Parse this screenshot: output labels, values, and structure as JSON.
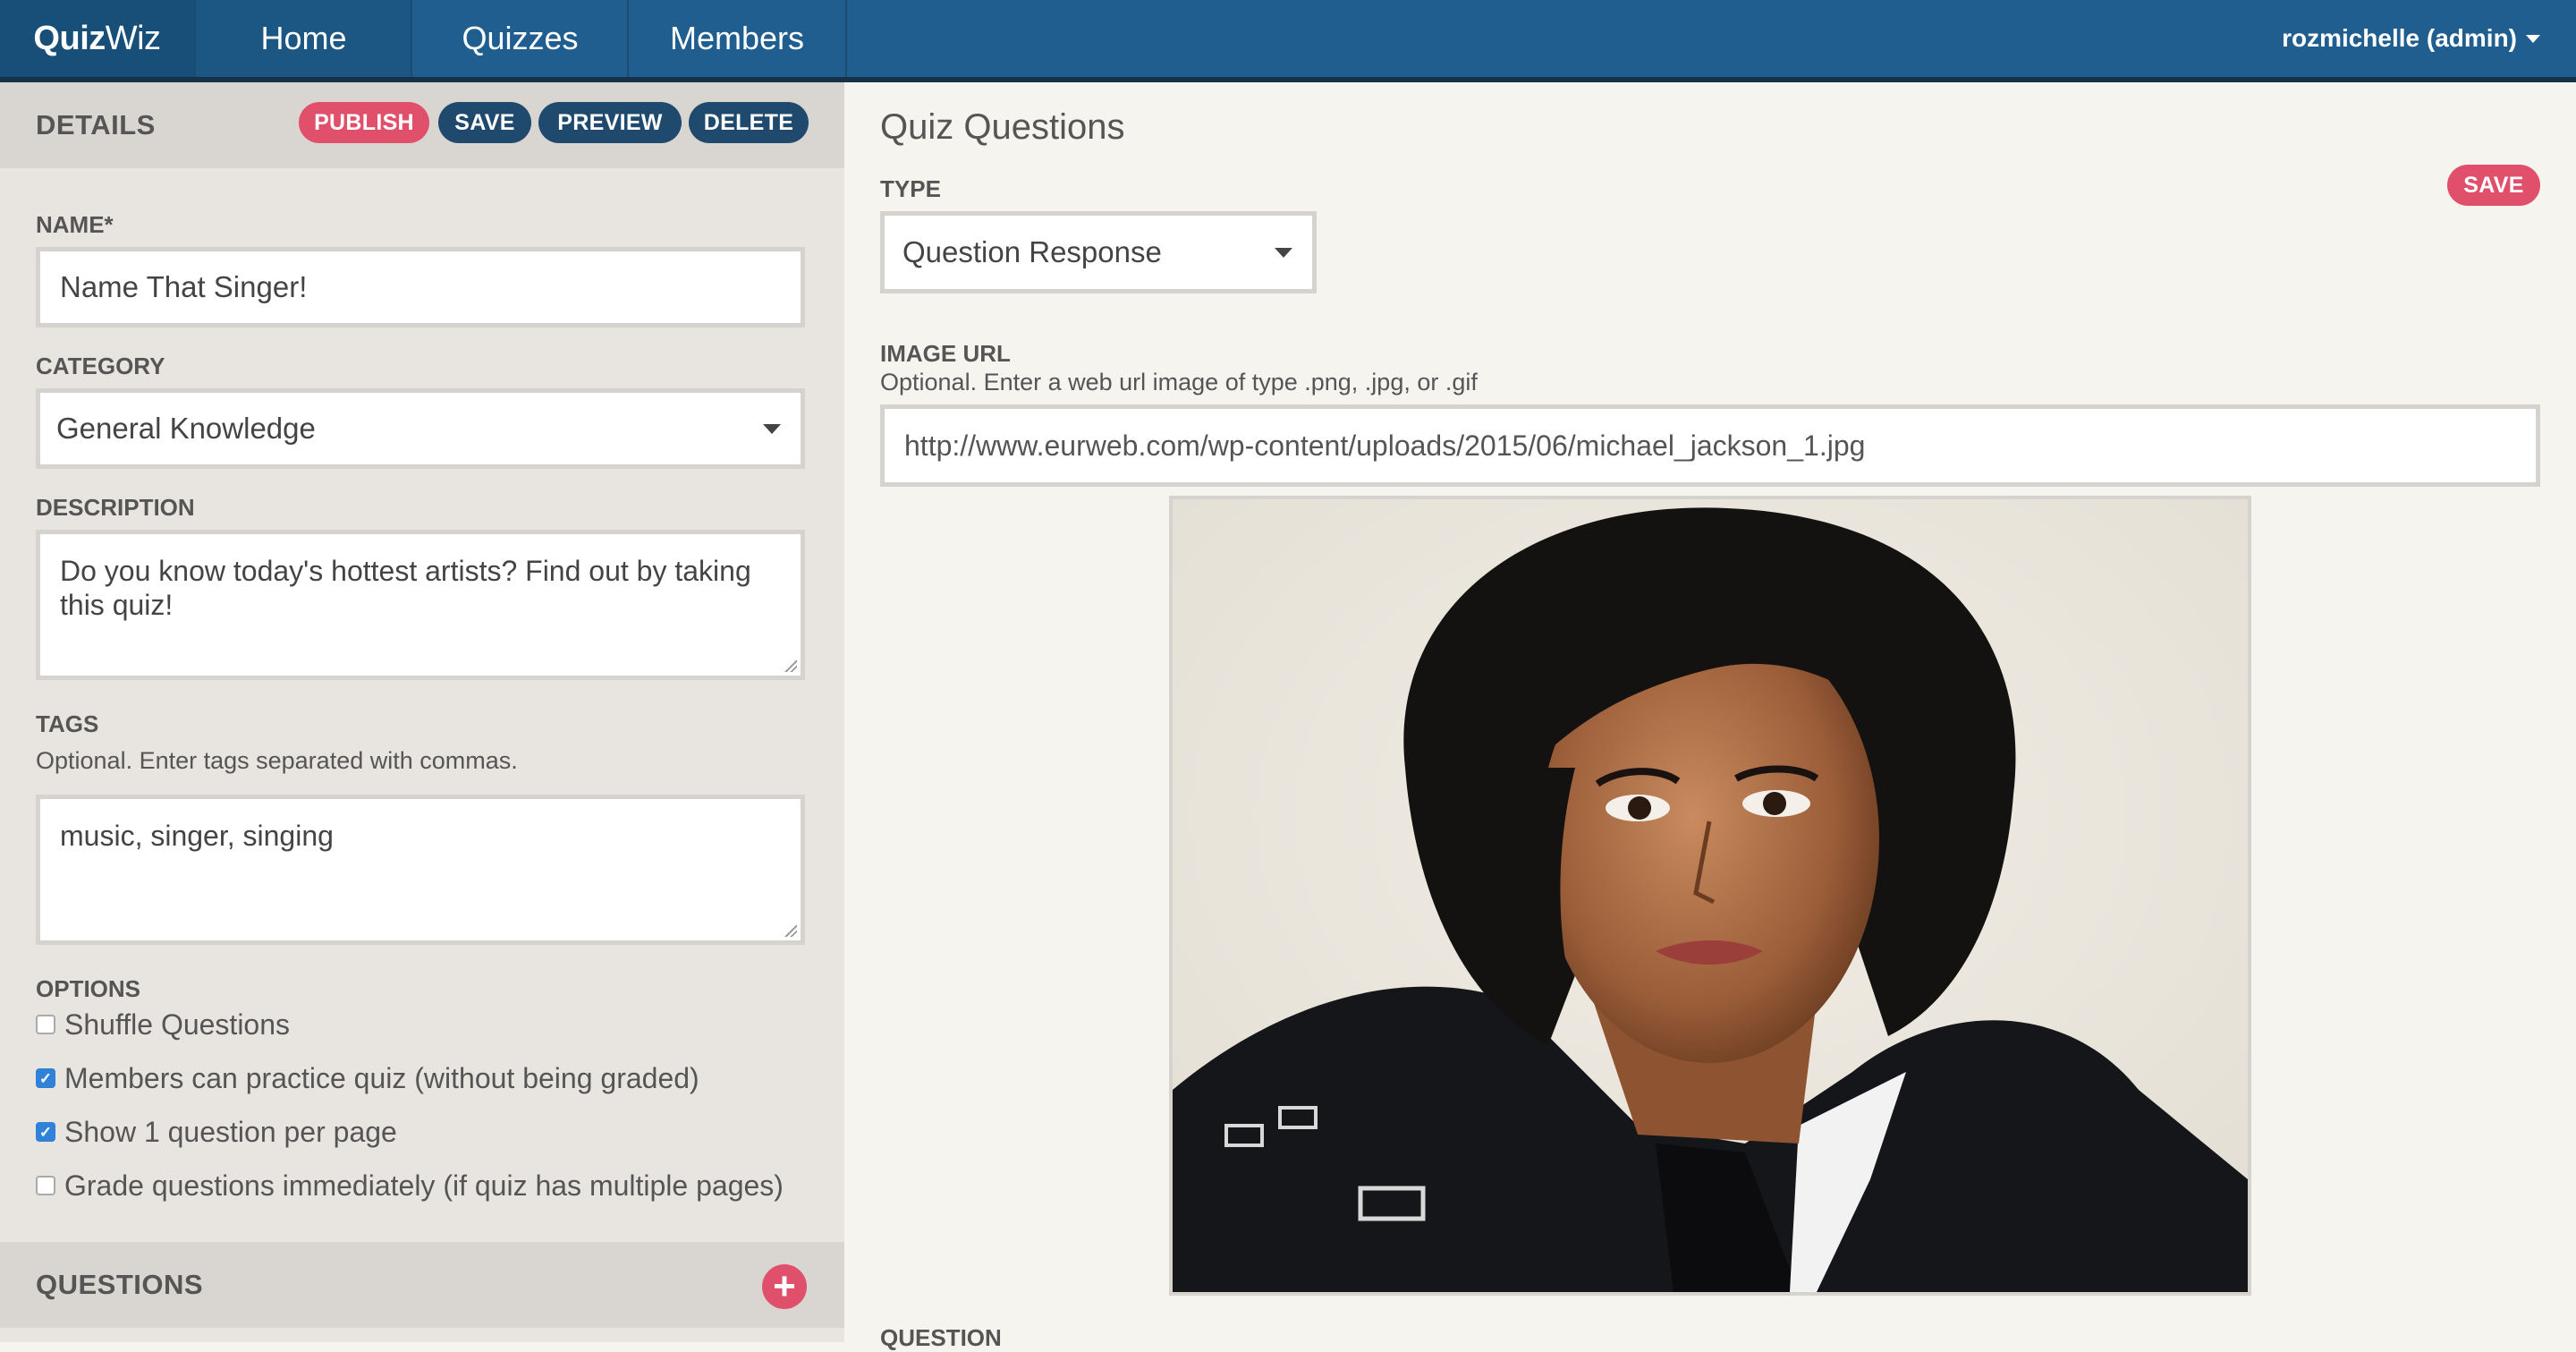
{
  "brand": {
    "bold": "Quiz",
    "light": "Wiz"
  },
  "nav": {
    "home": "Home",
    "quizzes": "Quizzes",
    "members": "Members"
  },
  "user": {
    "label": "rozmichelle (admin)"
  },
  "details": {
    "title": "DETAILS",
    "buttons": {
      "publish": "PUBLISH",
      "save": "SAVE",
      "preview": "PREVIEW",
      "delete": "DELETE"
    },
    "name": {
      "label": "NAME*",
      "value": "Name That Singer!"
    },
    "category": {
      "label": "CATEGORY",
      "value": "General Knowledge"
    },
    "description": {
      "label": "DESCRIPTION",
      "value": "Do you know today's hottest artists? Find out by taking this quiz!"
    },
    "tags": {
      "label": "TAGS",
      "help": "Optional. Enter tags separated with commas.",
      "value": "music, singer, singing"
    },
    "options": {
      "label": "OPTIONS",
      "items": [
        {
          "label": "Shuffle Questions",
          "checked": false
        },
        {
          "label": "Members can practice quiz (without being graded)",
          "checked": true
        },
        {
          "label": "Show 1 question per page",
          "checked": true
        },
        {
          "label": "Grade questions immediately (if quiz has multiple pages)",
          "checked": false
        }
      ]
    }
  },
  "questions_section": {
    "title": "QUESTIONS"
  },
  "quiz_questions": {
    "title": "Quiz Questions",
    "save": "SAVE",
    "type": {
      "label": "TYPE",
      "value": "Question Response"
    },
    "image_url": {
      "label": "IMAGE URL",
      "help": "Optional. Enter a web url image of type .png, .jpg, or .gif",
      "value": "http://www.eurweb.com/wp-content/uploads/2015/06/michael_jackson_1.jpg"
    },
    "question": {
      "label": "QUESTION"
    }
  },
  "colors": {
    "nav": "#1f5e8f",
    "brand_bg": "#174f79",
    "accent_red": "#e0506a",
    "button_blue": "#1f4a6e",
    "left_panel": "#e8e5e0",
    "section_head": "#d9d6d1",
    "right_panel": "#f6f4ef",
    "checkbox_blue": "#2f82d8"
  },
  "icons": {
    "user_caret": "chevron-down-icon",
    "select_caret": "chevron-down-icon",
    "add_question": "plus-icon",
    "checked": "check-icon"
  }
}
